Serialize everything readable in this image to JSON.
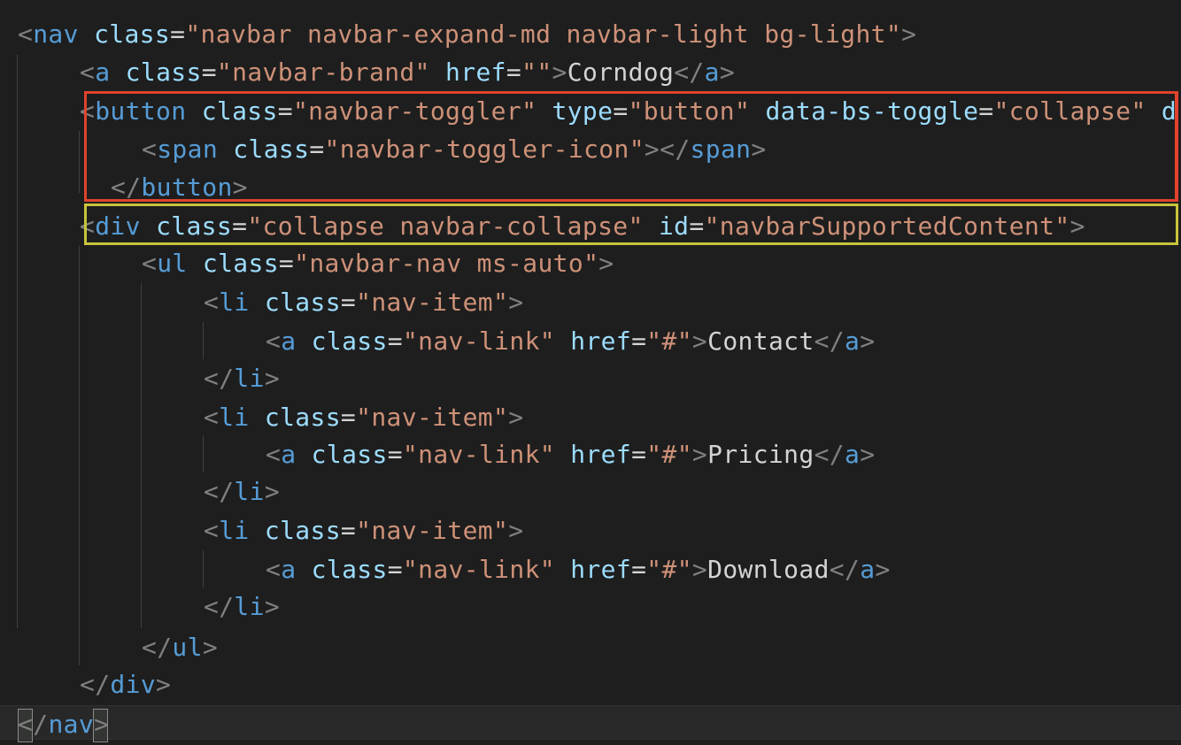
{
  "code": {
    "lines": [
      {
        "indent": 0,
        "tokens": [
          {
            "t": "<",
            "c": "punc"
          },
          {
            "t": "nav",
            "c": "tag"
          },
          {
            "t": " ",
            "c": "text"
          },
          {
            "t": "class",
            "c": "attr"
          },
          {
            "t": "=",
            "c": "eq"
          },
          {
            "t": "\"navbar navbar-expand-md navbar-light bg-light\"",
            "c": "str"
          },
          {
            "t": ">",
            "c": "punc"
          }
        ]
      },
      {
        "indent": 1,
        "tokens": [
          {
            "t": "<",
            "c": "punc"
          },
          {
            "t": "a",
            "c": "tag"
          },
          {
            "t": " ",
            "c": "text"
          },
          {
            "t": "class",
            "c": "attr"
          },
          {
            "t": "=",
            "c": "eq"
          },
          {
            "t": "\"navbar-brand\"",
            "c": "str"
          },
          {
            "t": " ",
            "c": "text"
          },
          {
            "t": "href",
            "c": "attr"
          },
          {
            "t": "=",
            "c": "eq"
          },
          {
            "t": "\"\"",
            "c": "str"
          },
          {
            "t": ">",
            "c": "punc"
          },
          {
            "t": "Corndog",
            "c": "text"
          },
          {
            "t": "</",
            "c": "punc"
          },
          {
            "t": "a",
            "c": "tag"
          },
          {
            "t": ">",
            "c": "punc"
          }
        ]
      },
      {
        "indent": 1,
        "tokens": [
          {
            "t": "<",
            "c": "punc"
          },
          {
            "t": "button",
            "c": "tag"
          },
          {
            "t": " ",
            "c": "text"
          },
          {
            "t": "class",
            "c": "attr"
          },
          {
            "t": "=",
            "c": "eq"
          },
          {
            "t": "\"navbar-toggler\"",
            "c": "str"
          },
          {
            "t": " ",
            "c": "text"
          },
          {
            "t": "type",
            "c": "attr"
          },
          {
            "t": "=",
            "c": "eq"
          },
          {
            "t": "\"button\"",
            "c": "str"
          },
          {
            "t": " ",
            "c": "text"
          },
          {
            "t": "data-bs-toggle",
            "c": "attr"
          },
          {
            "t": "=",
            "c": "eq"
          },
          {
            "t": "\"collapse\"",
            "c": "str"
          },
          {
            "t": " ",
            "c": "text"
          },
          {
            "t": "d",
            "c": "attr"
          }
        ]
      },
      {
        "indent": 2,
        "tokens": [
          {
            "t": "<",
            "c": "punc"
          },
          {
            "t": "span",
            "c": "tag"
          },
          {
            "t": " ",
            "c": "text"
          },
          {
            "t": "class",
            "c": "attr"
          },
          {
            "t": "=",
            "c": "eq"
          },
          {
            "t": "\"navbar-toggler-icon\"",
            "c": "str"
          },
          {
            "t": "></",
            "c": "punc"
          },
          {
            "t": "span",
            "c": "tag"
          },
          {
            "t": ">",
            "c": "punc"
          }
        ]
      },
      {
        "indent": 1.5,
        "tokens": [
          {
            "t": "</",
            "c": "punc"
          },
          {
            "t": "button",
            "c": "tag"
          },
          {
            "t": ">",
            "c": "punc"
          }
        ]
      },
      {
        "indent": 1,
        "tokens": [
          {
            "t": "<",
            "c": "punc"
          },
          {
            "t": "div",
            "c": "tag"
          },
          {
            "t": " ",
            "c": "text"
          },
          {
            "t": "class",
            "c": "attr"
          },
          {
            "t": "=",
            "c": "eq"
          },
          {
            "t": "\"collapse navbar-collapse\"",
            "c": "str"
          },
          {
            "t": " ",
            "c": "text"
          },
          {
            "t": "id",
            "c": "attr"
          },
          {
            "t": "=",
            "c": "eq"
          },
          {
            "t": "\"navbarSupportedContent\"",
            "c": "str"
          },
          {
            "t": ">",
            "c": "punc"
          }
        ]
      },
      {
        "indent": 2,
        "tokens": [
          {
            "t": "<",
            "c": "punc"
          },
          {
            "t": "ul",
            "c": "tag"
          },
          {
            "t": " ",
            "c": "text"
          },
          {
            "t": "class",
            "c": "attr"
          },
          {
            "t": "=",
            "c": "eq"
          },
          {
            "t": "\"navbar-nav ms-auto\"",
            "c": "str"
          },
          {
            "t": ">",
            "c": "punc"
          }
        ]
      },
      {
        "indent": 3,
        "tokens": [
          {
            "t": "<",
            "c": "punc"
          },
          {
            "t": "li",
            "c": "tag"
          },
          {
            "t": " ",
            "c": "text"
          },
          {
            "t": "class",
            "c": "attr"
          },
          {
            "t": "=",
            "c": "eq"
          },
          {
            "t": "\"nav-item\"",
            "c": "str"
          },
          {
            "t": ">",
            "c": "punc"
          }
        ]
      },
      {
        "indent": 4,
        "tokens": [
          {
            "t": "<",
            "c": "punc"
          },
          {
            "t": "a",
            "c": "tag"
          },
          {
            "t": " ",
            "c": "text"
          },
          {
            "t": "class",
            "c": "attr"
          },
          {
            "t": "=",
            "c": "eq"
          },
          {
            "t": "\"nav-link\"",
            "c": "str"
          },
          {
            "t": " ",
            "c": "text"
          },
          {
            "t": "href",
            "c": "attr"
          },
          {
            "t": "=",
            "c": "eq"
          },
          {
            "t": "\"#\"",
            "c": "str"
          },
          {
            "t": ">",
            "c": "punc"
          },
          {
            "t": "Contact",
            "c": "text"
          },
          {
            "t": "</",
            "c": "punc"
          },
          {
            "t": "a",
            "c": "tag"
          },
          {
            "t": ">",
            "c": "punc"
          }
        ]
      },
      {
        "indent": 3,
        "tokens": [
          {
            "t": "</",
            "c": "punc"
          },
          {
            "t": "li",
            "c": "tag"
          },
          {
            "t": ">",
            "c": "punc"
          }
        ]
      },
      {
        "indent": 3,
        "tokens": [
          {
            "t": "<",
            "c": "punc"
          },
          {
            "t": "li",
            "c": "tag"
          },
          {
            "t": " ",
            "c": "text"
          },
          {
            "t": "class",
            "c": "attr"
          },
          {
            "t": "=",
            "c": "eq"
          },
          {
            "t": "\"nav-item\"",
            "c": "str"
          },
          {
            "t": ">",
            "c": "punc"
          }
        ]
      },
      {
        "indent": 4,
        "tokens": [
          {
            "t": "<",
            "c": "punc"
          },
          {
            "t": "a",
            "c": "tag"
          },
          {
            "t": " ",
            "c": "text"
          },
          {
            "t": "class",
            "c": "attr"
          },
          {
            "t": "=",
            "c": "eq"
          },
          {
            "t": "\"nav-link\"",
            "c": "str"
          },
          {
            "t": " ",
            "c": "text"
          },
          {
            "t": "href",
            "c": "attr"
          },
          {
            "t": "=",
            "c": "eq"
          },
          {
            "t": "\"#\"",
            "c": "str"
          },
          {
            "t": ">",
            "c": "punc"
          },
          {
            "t": "Pricing",
            "c": "text"
          },
          {
            "t": "</",
            "c": "punc"
          },
          {
            "t": "a",
            "c": "tag"
          },
          {
            "t": ">",
            "c": "punc"
          }
        ]
      },
      {
        "indent": 3,
        "tokens": [
          {
            "t": "</",
            "c": "punc"
          },
          {
            "t": "li",
            "c": "tag"
          },
          {
            "t": ">",
            "c": "punc"
          }
        ]
      },
      {
        "indent": 3,
        "tokens": [
          {
            "t": "<",
            "c": "punc"
          },
          {
            "t": "li",
            "c": "tag"
          },
          {
            "t": " ",
            "c": "text"
          },
          {
            "t": "class",
            "c": "attr"
          },
          {
            "t": "=",
            "c": "eq"
          },
          {
            "t": "\"nav-item\"",
            "c": "str"
          },
          {
            "t": ">",
            "c": "punc"
          }
        ]
      },
      {
        "indent": 4,
        "tokens": [
          {
            "t": "<",
            "c": "punc"
          },
          {
            "t": "a",
            "c": "tag"
          },
          {
            "t": " ",
            "c": "text"
          },
          {
            "t": "class",
            "c": "attr"
          },
          {
            "t": "=",
            "c": "eq"
          },
          {
            "t": "\"nav-link\"",
            "c": "str"
          },
          {
            "t": " ",
            "c": "text"
          },
          {
            "t": "href",
            "c": "attr"
          },
          {
            "t": "=",
            "c": "eq"
          },
          {
            "t": "\"#\"",
            "c": "str"
          },
          {
            "t": ">",
            "c": "punc"
          },
          {
            "t": "Download",
            "c": "text"
          },
          {
            "t": "</",
            "c": "punc"
          },
          {
            "t": "a",
            "c": "tag"
          },
          {
            "t": ">",
            "c": "punc"
          }
        ]
      },
      {
        "indent": 3,
        "tokens": [
          {
            "t": "</",
            "c": "punc"
          },
          {
            "t": "li",
            "c": "tag"
          },
          {
            "t": ">",
            "c": "punc"
          }
        ]
      },
      {
        "indent": 2,
        "tokens": [
          {
            "t": "</",
            "c": "punc"
          },
          {
            "t": "ul",
            "c": "tag"
          },
          {
            "t": ">",
            "c": "punc"
          }
        ]
      },
      {
        "indent": 1,
        "tokens": [
          {
            "t": "</",
            "c": "punc"
          },
          {
            "t": "div",
            "c": "tag"
          },
          {
            "t": ">",
            "c": "punc"
          }
        ]
      },
      {
        "indent": 0,
        "tokens": [
          {
            "t": "<",
            "c": "punc"
          },
          {
            "t": "/",
            "c": "punc"
          },
          {
            "t": "nav",
            "c": "tag"
          },
          {
            "t": ">",
            "c": "punc"
          }
        ]
      }
    ]
  },
  "colors": {
    "background": "#1e1e1e",
    "tag": "#569cd6",
    "attribute": "#9cdcfe",
    "string": "#ce9178",
    "text": "#d4d4d4",
    "punctuation": "#808080",
    "highlight_red": "#e0432c",
    "highlight_yellow": "#c9c43a"
  }
}
